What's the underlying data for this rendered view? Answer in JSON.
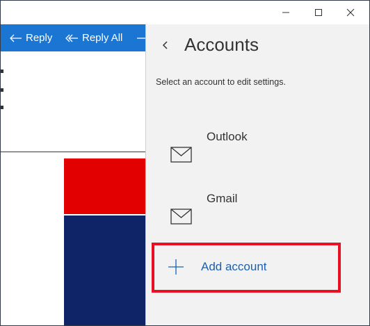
{
  "window": {
    "controls": [
      "minimize-icon",
      "maximize-icon",
      "close-icon"
    ]
  },
  "toolbar": {
    "reply_label": "Reply",
    "reply_all_label": "Reply All"
  },
  "accounts_pane": {
    "title": "Accounts",
    "subtitle": "Select an account to edit settings.",
    "accounts": [
      {
        "name": "Outlook",
        "icon": "mail-icon"
      },
      {
        "name": "Gmail",
        "icon": "mail-icon"
      }
    ],
    "add_account_label": "Add account",
    "highlight_color": "#e81123"
  },
  "colors": {
    "toolbar_bg": "#1a76d2",
    "pane_bg": "#f2f2f2",
    "link": "#1a5fb4",
    "image_red": "#e20000",
    "image_blue": "#0f2466"
  }
}
